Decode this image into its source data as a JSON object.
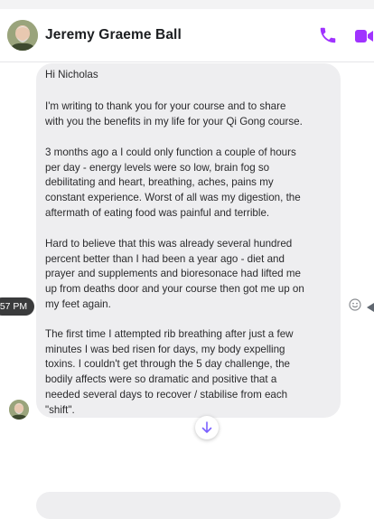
{
  "contact": {
    "name": "Jeremy Graeme Ball"
  },
  "colors": {
    "accent": "#a033ff",
    "bubble": "#eeeef0",
    "time_pill": "#3a3b3c"
  },
  "icons": {
    "call": "phone-icon",
    "video": "video-camera-icon",
    "react": "smiley-icon",
    "more": "more-arrow-icon",
    "scroll": "arrow-down-icon"
  },
  "message": {
    "time": "57 PM",
    "paragraphs": [
      {
        "lines": [
          "Hi Nicholas"
        ]
      },
      {
        "lines": [
          "I'm writing to thank you for your course and to share",
          "with you the benefits in my life for your Qi Gong course."
        ]
      },
      {
        "lines": [
          "3 months ago a I could only function a couple of hours",
          "per day - energy levels were so low, brain fog so",
          "debilitating and heart, breathing, aches, pains my",
          "constant experience. Worst of all was my digestion, the",
          "aftermath of eating food was painful and terrible."
        ]
      },
      {
        "lines": [
          "Hard to believe that this was already several hundred",
          "percent better than I had been a year ago - diet and",
          "prayer and supplements and bioresonace had lifted me",
          "up from deaths door and your course then got me up on",
          "my feet again."
        ]
      },
      {
        "lines": [
          "The first time I attempted rib breathing after just a few",
          "minutes I was bed risen for days, my body expelling",
          "toxins. I couldn't get through the 5 day challenge, the",
          "bodily affects were so dramatic and positive that a",
          "needed several days to recover / stabilise from each",
          "\"shift\"."
        ]
      }
    ]
  }
}
